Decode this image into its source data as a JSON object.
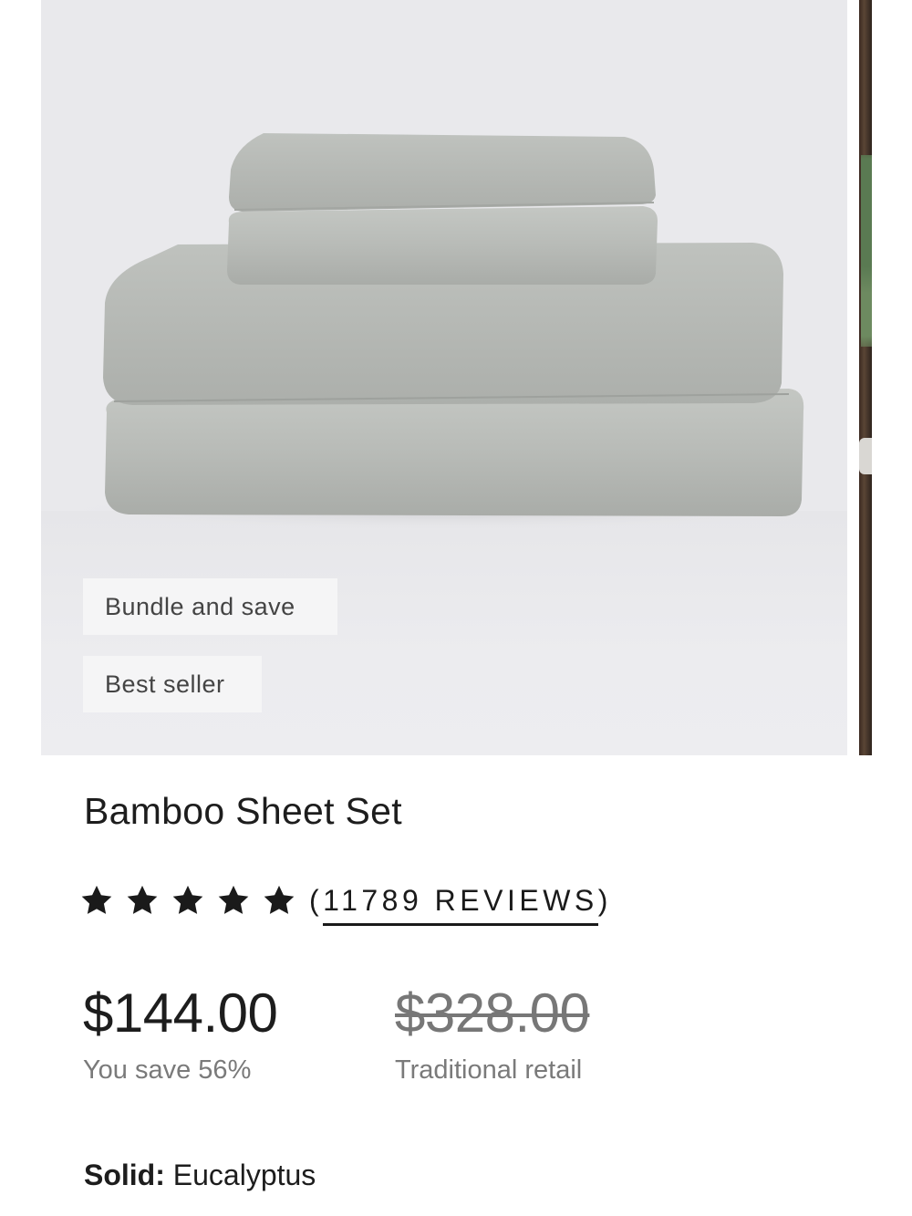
{
  "product": {
    "badges": [
      "Bundle and save",
      "Best seller"
    ],
    "title": "Bamboo Sheet Set",
    "rating": {
      "stars": 5,
      "open_paren": "(",
      "reviews_label": "11789 REVIEWS",
      "close_paren": ")"
    },
    "price": {
      "current": "$144.00",
      "savings": "You save 56%",
      "retail": "$328.00",
      "retail_label": "Traditional retail"
    },
    "variant": {
      "label": "Solid:",
      "value": "Eucalyptus"
    }
  },
  "colors": {
    "sheet": "#b7bab6",
    "background": "#e9e9ec",
    "text": "#1d1d1d",
    "muted": "#7a7a7a"
  },
  "icons": {
    "star": "star-icon"
  }
}
